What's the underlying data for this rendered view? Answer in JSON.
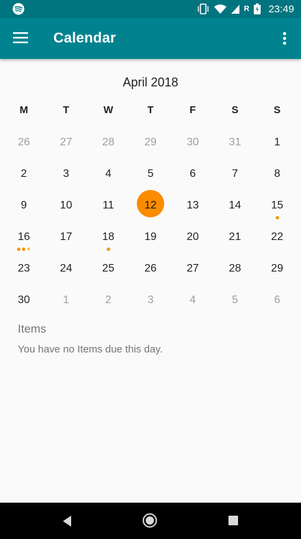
{
  "status_bar": {
    "time": "23:49",
    "roaming_label": "R",
    "icons": [
      "spotify-icon",
      "vibrate-icon",
      "wifi-icon",
      "signal-icon",
      "battery-icon"
    ]
  },
  "app_bar": {
    "title": "Calendar",
    "menu_icon": "hamburger-menu-icon",
    "more_icon": "more-vert-icon"
  },
  "calendar": {
    "month_title": "April 2018",
    "weekday_headers": [
      "M",
      "T",
      "W",
      "T",
      "F",
      "S",
      "S"
    ],
    "selected_day": "12",
    "selected_color": "#fb8c00",
    "event_dot_color": "#ef9a00",
    "weeks": [
      [
        {
          "d": "26",
          "o": true
        },
        {
          "d": "27",
          "o": true
        },
        {
          "d": "28",
          "o": true
        },
        {
          "d": "29",
          "o": true
        },
        {
          "d": "30",
          "o": true
        },
        {
          "d": "31",
          "o": true
        },
        {
          "d": "1"
        }
      ],
      [
        {
          "d": "2"
        },
        {
          "d": "3"
        },
        {
          "d": "4"
        },
        {
          "d": "5"
        },
        {
          "d": "6"
        },
        {
          "d": "7"
        },
        {
          "d": "8"
        }
      ],
      [
        {
          "d": "9"
        },
        {
          "d": "10"
        },
        {
          "d": "11"
        },
        {
          "d": "12",
          "sel": true
        },
        {
          "d": "13"
        },
        {
          "d": "14"
        },
        {
          "d": "15",
          "dots": 1
        }
      ],
      [
        {
          "d": "16",
          "dots": 2,
          "plus": true
        },
        {
          "d": "17"
        },
        {
          "d": "18",
          "dots": 1
        },
        {
          "d": "19"
        },
        {
          "d": "20"
        },
        {
          "d": "21"
        },
        {
          "d": "22"
        }
      ],
      [
        {
          "d": "23"
        },
        {
          "d": "24"
        },
        {
          "d": "25"
        },
        {
          "d": "26"
        },
        {
          "d": "27"
        },
        {
          "d": "28"
        },
        {
          "d": "29"
        }
      ],
      [
        {
          "d": "30"
        },
        {
          "d": "1",
          "o": true
        },
        {
          "d": "2",
          "o": true
        },
        {
          "d": "3",
          "o": true
        },
        {
          "d": "4",
          "o": true
        },
        {
          "d": "5",
          "o": true
        },
        {
          "d": "6",
          "o": true
        }
      ]
    ]
  },
  "items": {
    "title": "Items",
    "empty_message": "You have no Items due this day."
  },
  "nav_bar": {
    "buttons": [
      "back-icon",
      "home-icon",
      "recents-icon"
    ]
  }
}
